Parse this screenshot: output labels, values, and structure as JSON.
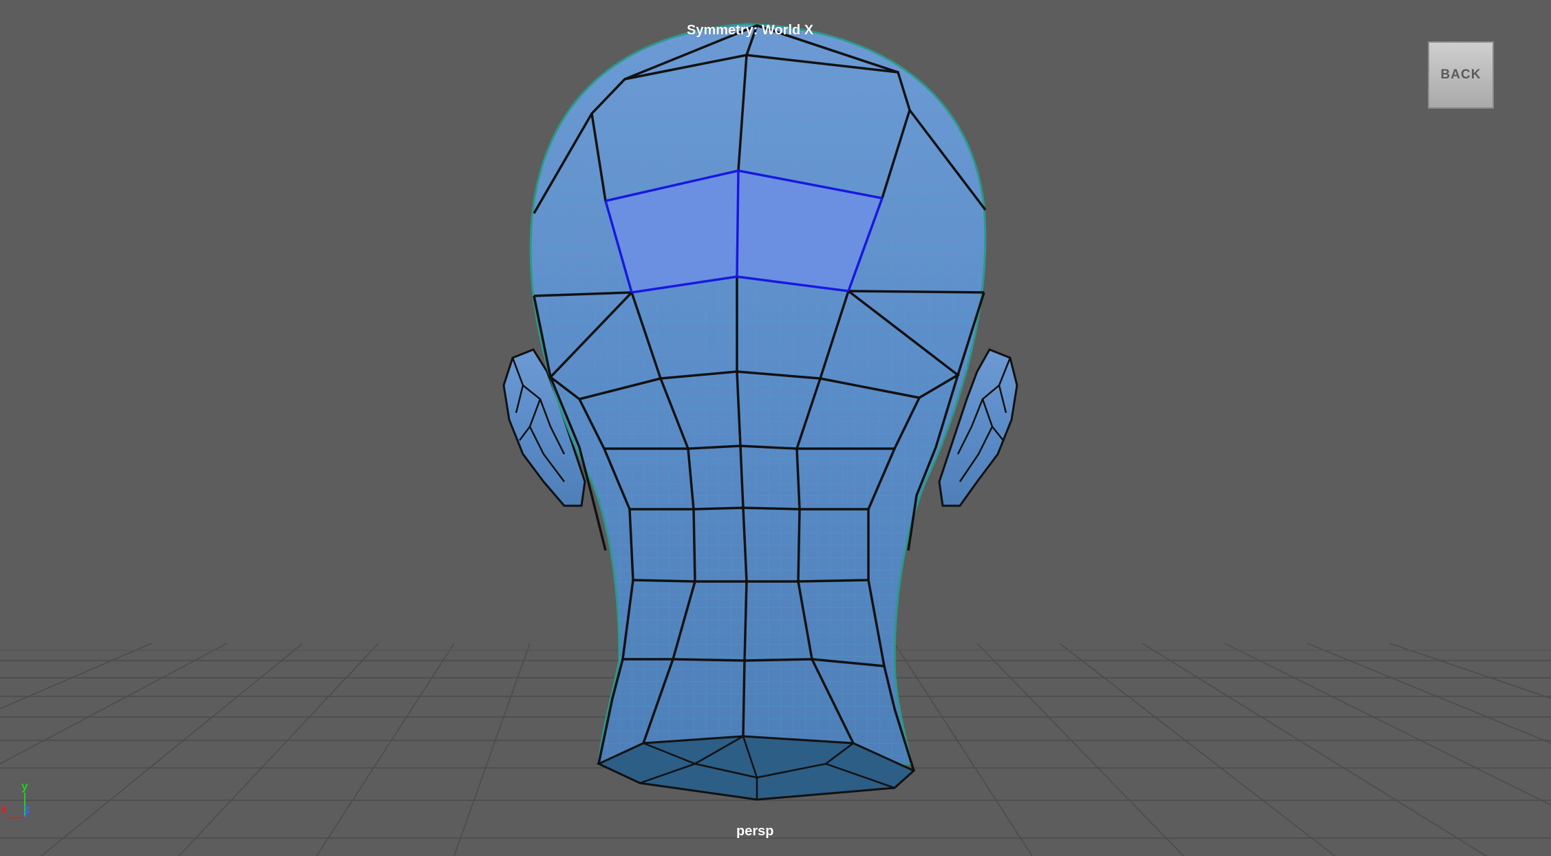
{
  "viewport": {
    "symmetry_label": "Symmetry: World X",
    "camera_name": "persp",
    "back_button_label": "BACK"
  },
  "axis_gizmo": {
    "x_label": "x",
    "y_label": "y",
    "z_label": "z",
    "x_color": "#e02020",
    "y_color": "#20d020",
    "z_color": "#2a6cff"
  },
  "colors": {
    "background": "#5d5d5d",
    "grid_line": "#4a4a4a",
    "mesh_fill": "#5e8fcb",
    "mesh_edge": "#111111",
    "selected_face": "#6a8fe0",
    "selected_edge": "#1a1adc",
    "smooth_wire": "#3aa9c9"
  },
  "icons": {
    "axis": "axis-gizmo-icon"
  }
}
